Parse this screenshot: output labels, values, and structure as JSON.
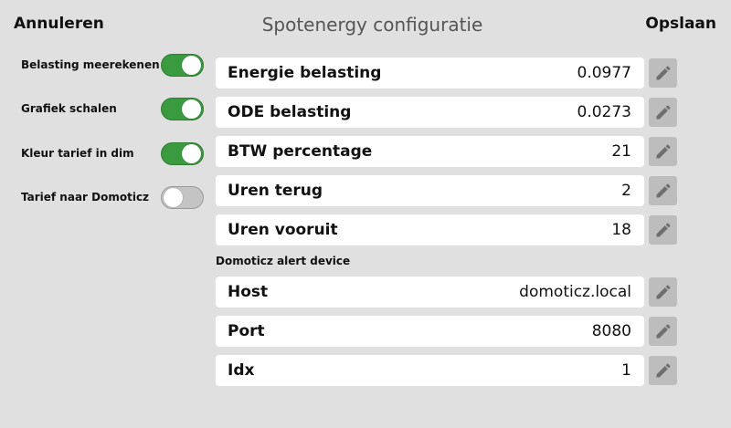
{
  "header": {
    "cancel_label": "Annuleren",
    "title": "Spotenergy configuratie",
    "save_label": "Opslaan"
  },
  "toggles": [
    {
      "label": "Belasting meerekenen",
      "on": true
    },
    {
      "label": "Grafiek schalen",
      "on": true
    },
    {
      "label": "Kleur tarief in dim",
      "on": true
    },
    {
      "label": "Tarief naar Domoticz",
      "on": false
    }
  ],
  "fields": [
    {
      "label": "Energie belasting",
      "value": "0.0977"
    },
    {
      "label": "ODE belasting",
      "value": "0.0273"
    },
    {
      "label": "BTW percentage",
      "value": "21"
    },
    {
      "label": "Uren terug",
      "value": "2"
    },
    {
      "label": "Uren vooruit",
      "value": "18"
    }
  ],
  "domoticz": {
    "section_label": "Domoticz alert device",
    "fields": [
      {
        "label": "Host",
        "value": "domoticz.local"
      },
      {
        "label": "Port",
        "value": "8080"
      },
      {
        "label": "Idx",
        "value": "1"
      }
    ]
  },
  "colors": {
    "background": "#e0e0e0",
    "toggle_on": "#3a9a3e",
    "toggle_off": "#c4c4c4",
    "edit_button": "#bdbdbd"
  },
  "icons": {
    "edit": "pencil-icon"
  }
}
